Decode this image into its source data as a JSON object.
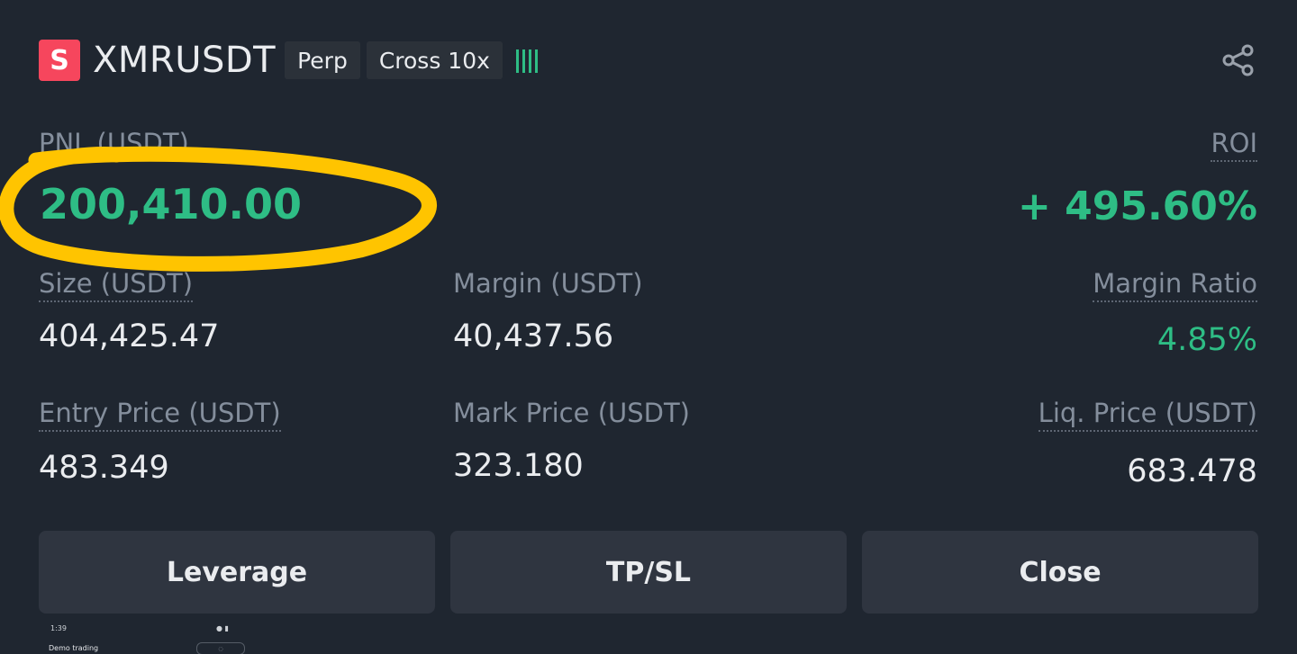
{
  "header": {
    "logo_letter": "S",
    "symbol": "XMRUSDT",
    "tag_type": "Perp",
    "tag_margin": "Cross 10x"
  },
  "pnl": {
    "label": "PNL (USDT)",
    "value": "200,410.00"
  },
  "roi": {
    "label": "ROI",
    "value": "+ 495.60%"
  },
  "stats": {
    "size_label": "Size (USDT)",
    "size_value": "404,425.47",
    "margin_label": "Margin (USDT)",
    "margin_value": "40,437.56",
    "margin_ratio_label": "Margin Ratio",
    "margin_ratio_value": "4.85%",
    "entry_label": "Entry Price (USDT)",
    "entry_value": "483.349",
    "mark_label": "Mark Price (USDT)",
    "mark_value": "323.180",
    "liq_label": "Liq. Price (USDT)",
    "liq_value": "683.478"
  },
  "buttons": {
    "leverage": "Leverage",
    "tpsl": "TP/SL",
    "close": "Close"
  },
  "mini_screenshot": {
    "status_time": "1:39",
    "title": "Demo trading"
  },
  "colors": {
    "background": "#1f2630",
    "positive": "#2ebd85",
    "logo": "#f6465d",
    "annotation": "#ffc400"
  },
  "icons": {
    "share": "share-icon",
    "signal": "signal-bars-icon"
  }
}
